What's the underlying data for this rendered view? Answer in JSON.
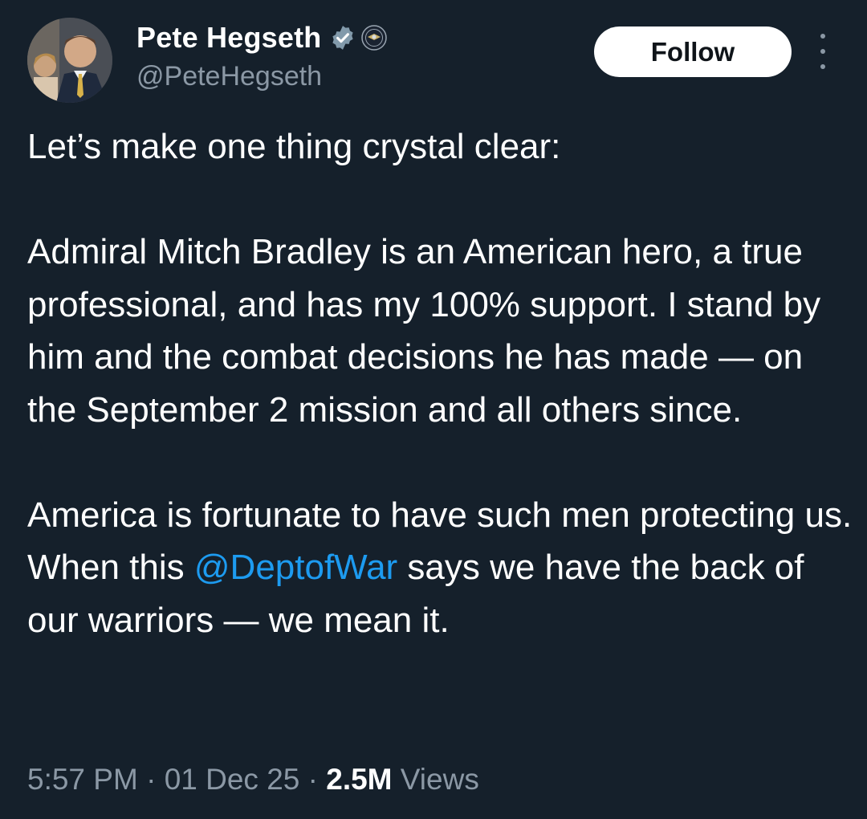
{
  "author": {
    "display_name": "Pete Hegseth",
    "handle": "@PeteHegseth",
    "verified_icon": "verified-badge-icon",
    "affiliation_icon": "department-seal-icon"
  },
  "actions": {
    "follow_label": "Follow",
    "more_icon": "more-vertical-icon"
  },
  "tweet": {
    "line1": "Let’s make one thing crystal clear:",
    "para2": "Admiral Mitch Bradley is an American hero, a true professional, and has my 100% support. I stand by him and the combat decisions he has made — on the September 2 mission and all others since.",
    "para3_before": "America is fortunate to have such men protecting us. When this ",
    "para3_mention": "@DeptofWar",
    "para3_after": " says we have the back of our warriors — we mean it."
  },
  "meta": {
    "time": "5:57 PM",
    "sep1": " · ",
    "date": "01 Dec 25",
    "sep2": " · ",
    "views_count": "2.5M",
    "views_label": " Views"
  },
  "colors": {
    "background": "#15202b",
    "text": "#ffffff",
    "secondary": "#8b98a5",
    "link": "#1d9bf0"
  }
}
